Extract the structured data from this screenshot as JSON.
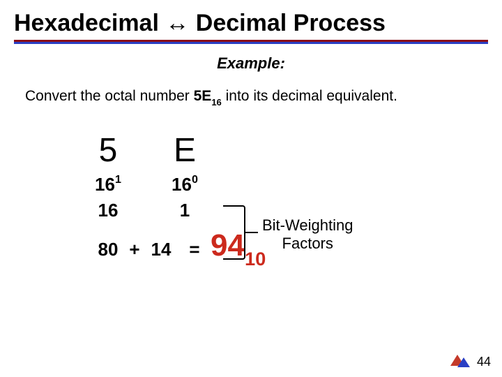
{
  "title": "Hexadecimal ↔ Decimal Process",
  "example_label": "Example:",
  "prompt": {
    "pre": "Convert the octal number ",
    "num": "5E",
    "base": "16",
    "post": " into its decimal equivalent."
  },
  "digits": [
    "5",
    "E"
  ],
  "places": [
    {
      "base": "16",
      "exp": "1"
    },
    {
      "base": "16",
      "exp": "0"
    }
  ],
  "place_values": [
    "16",
    "1"
  ],
  "bit_label_l1": "Bit-Weighting",
  "bit_label_l2": "Factors",
  "sum": {
    "terms": [
      "80",
      "14"
    ],
    "op": "+",
    "eq": "="
  },
  "result": {
    "value": "94",
    "base": "10"
  },
  "page_number": "44"
}
